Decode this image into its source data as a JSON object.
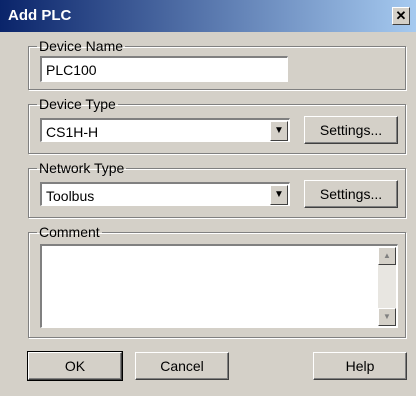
{
  "window": {
    "title": "Add PLC",
    "close_glyph": "✕"
  },
  "device_name": {
    "label": "Device Name",
    "value": "PLC100"
  },
  "device_type": {
    "label": "Device Type",
    "selected": "CS1H-H",
    "settings_label": "Settings..."
  },
  "network_type": {
    "label": "Network Type",
    "selected": "Toolbus",
    "settings_label": "Settings..."
  },
  "comment": {
    "label": "Comment",
    "value": ""
  },
  "buttons": {
    "ok": "OK",
    "cancel": "Cancel",
    "help": "Help"
  },
  "icons": {
    "close": "close-icon",
    "dropdown": "chevron-down-icon",
    "scroll_up": "scroll-up-icon",
    "scroll_down": "scroll-down-icon"
  }
}
